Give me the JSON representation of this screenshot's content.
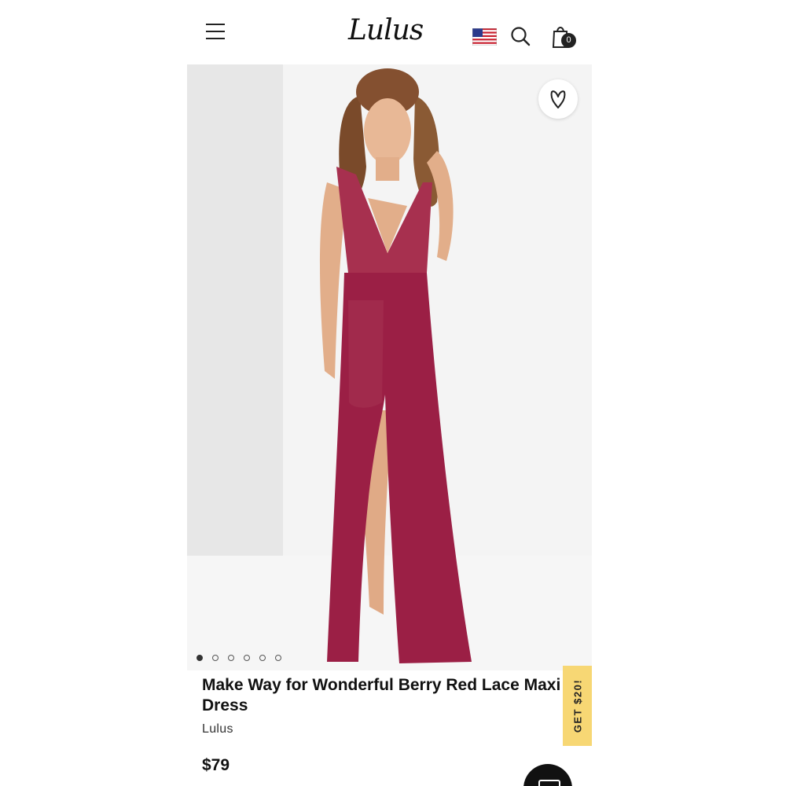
{
  "header": {
    "logo": "Lulus",
    "cart_count": "0",
    "icons": [
      "menu-icon",
      "us-flag-icon",
      "search-icon",
      "shopping-bag-icon"
    ]
  },
  "gallery": {
    "favorite_icon": "heart-icon",
    "slide_count": 6,
    "active_slide": 1
  },
  "product": {
    "title": "Make Way for Wonderful Berry Red Lace Maxi Dress",
    "brand": "Lulus",
    "price": "$79"
  },
  "promo": {
    "label": "GET $20!"
  },
  "chat": {
    "icon": "chat-icon"
  },
  "colors": {
    "dress": "#9b1f45",
    "promo": "#f7d774",
    "dark": "#111111"
  }
}
